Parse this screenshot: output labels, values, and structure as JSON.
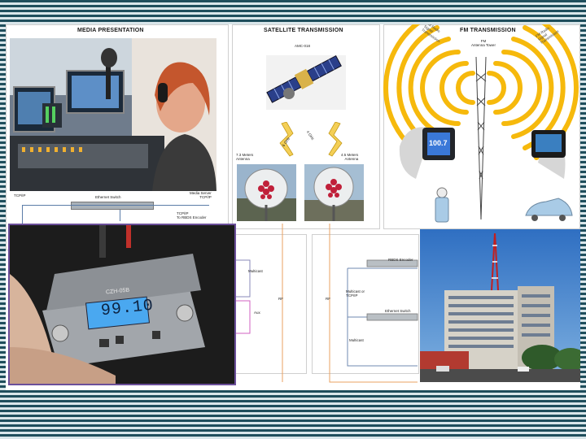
{
  "sections": {
    "media": "MEDIA PRESENTATION",
    "satellite": "SATELLITE TRANSMISSION",
    "fm": "FM TRANSMISSION"
  },
  "satellite_panel": {
    "satellite_name": "AMC-018",
    "uplink": "6 GHz",
    "downlink": "4 GHz",
    "left_antenna": "7.3 Meters\nAntenna",
    "right_antenna": "4.5 Meters\nAntenna"
  },
  "fm_panel": {
    "tower": "FM\nAntenna Tower",
    "radio_display": "100.7",
    "left_signal": "FM Radio\nSignal\nTransmission",
    "right_signal": "FM Radio\nSignal\nTransmission"
  },
  "media_panel": {
    "left_tcpip": "TCP/IP",
    "right_tcpip": "Media Server\nTCP/IP",
    "switch": "Ethernet Switch",
    "streamer_label": "TCP/IP\nTo RBDS Encoder"
  },
  "lower_diagram": {
    "multicast_left": "Multicast",
    "aux_left": "Aux",
    "rf_left": "RF",
    "rf_right": "RF",
    "rbds": "RBDS Encoder",
    "multicast_tcpip": "Multicast or\nTCP/IP",
    "switch": "Ethernet Switch",
    "multicast_right": "Multicast"
  },
  "transmitter": {
    "brand": "CZH-05B",
    "frequency": "99.10"
  },
  "colors": {
    "accent_stripe": "#1f4e5c",
    "rf_line": "#e8a060",
    "lcd": "#4aa8f0"
  }
}
